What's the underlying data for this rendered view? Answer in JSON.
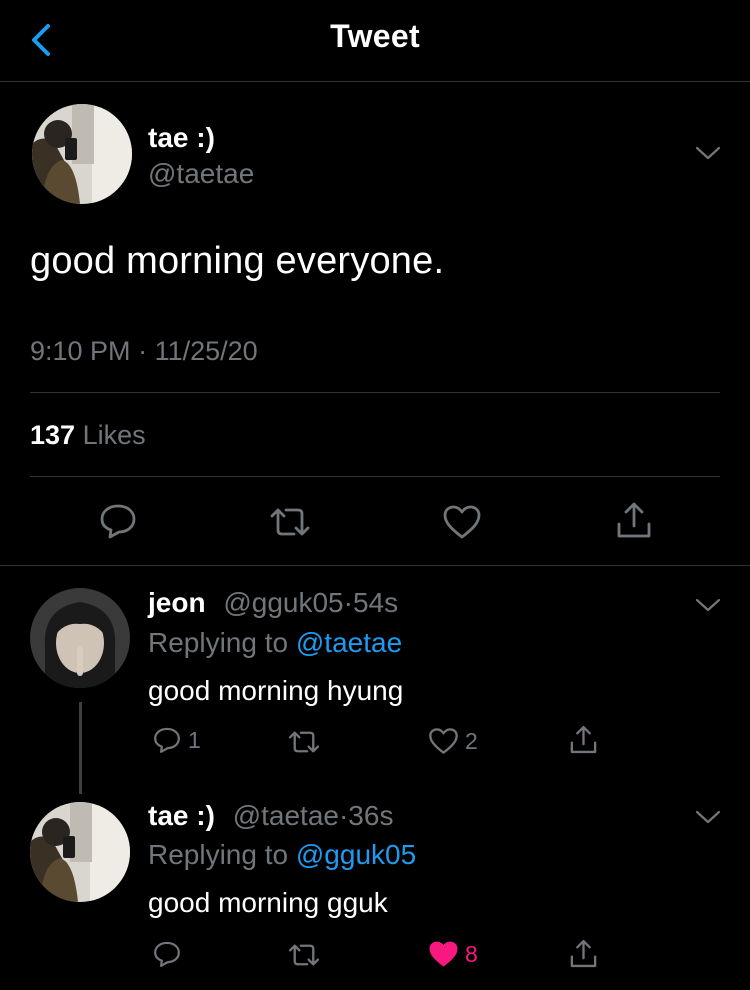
{
  "nav": {
    "title": "Tweet"
  },
  "main_tweet": {
    "display_name": "tae :)",
    "handle": "@taetae",
    "text": "good morning everyone.",
    "time": "9:10 PM",
    "dot": "·",
    "date": "11/25/20",
    "likes_count": "137",
    "likes_label": "Likes"
  },
  "replies": [
    {
      "display_name": "jeon",
      "handle": "@gguk05",
      "dot": "·",
      "time_ago": "54s",
      "replying_prefix": "Replying to",
      "replying_to": "@taetae",
      "text": "good morning hyung",
      "reply_count": "1",
      "retweet_count": "",
      "like_count": "2",
      "liked": false
    },
    {
      "display_name": "tae :)",
      "handle": "@taetae",
      "dot": "·",
      "time_ago": "36s",
      "replying_prefix": "Replying to",
      "replying_to": "@gguk05",
      "text": "good morning gguk",
      "reply_count": "",
      "retweet_count": "",
      "like_count": "8",
      "liked": true
    }
  ],
  "colors": {
    "background": "#000000",
    "muted": "#71767b",
    "link": "#1d9bf0",
    "like_active": "#f91880",
    "divider": "#2f3336"
  }
}
